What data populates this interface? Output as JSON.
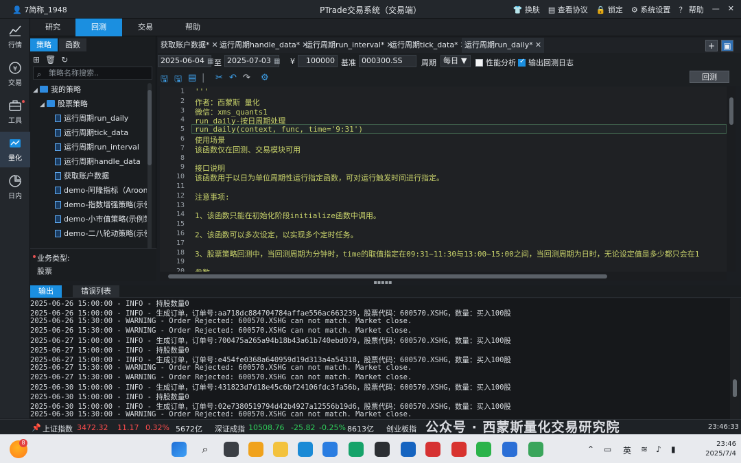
{
  "window": {
    "user": "7简称_1948",
    "title": "PTrade交易系统（交易端）",
    "actions": [
      "换肤",
      "查看协议",
      "锁定",
      "系统设置",
      "帮助"
    ]
  },
  "rail": [
    {
      "label": "行情",
      "icon": "chart-icon"
    },
    {
      "label": "交易",
      "icon": "yuan-icon"
    },
    {
      "label": "工具",
      "icon": "toolbox-icon"
    },
    {
      "label": "量化",
      "icon": "quant-icon"
    },
    {
      "label": "日内",
      "icon": "intraday-icon"
    }
  ],
  "menu": [
    "研究",
    "回测",
    "交易",
    "帮助"
  ],
  "strategy": {
    "tabs": [
      "策略",
      "函数"
    ],
    "search_placeholder": "策略名称搜索..",
    "tree": [
      {
        "label": "我的策略",
        "level": 0,
        "type": "folder"
      },
      {
        "label": "股票策略",
        "level": 1,
        "type": "folder"
      },
      {
        "label": "运行周期run_daily",
        "level": 2,
        "type": "file"
      },
      {
        "label": "运行周期tick_data",
        "level": 2,
        "type": "file"
      },
      {
        "label": "运行周期run_interval",
        "level": 2,
        "type": "file"
      },
      {
        "label": "运行周期handle_data",
        "level": 2,
        "type": "file"
      },
      {
        "label": "获取账户数据",
        "level": 2,
        "type": "file"
      },
      {
        "label": "demo-阿隆指标（Aroon）",
        "level": 2,
        "type": "file"
      },
      {
        "label": "demo-指数增强策略(示例)",
        "level": 2,
        "type": "file"
      },
      {
        "label": "demo-小市值策略(示例策略)",
        "level": 2,
        "type": "file"
      },
      {
        "label": "demo-二八轮动策略(示例)",
        "level": 2,
        "type": "file"
      }
    ],
    "biz_type_label": "业务类型:",
    "biz_type_value": "股票"
  },
  "file_tabs": [
    {
      "label": "获取账户数据*"
    },
    {
      "label": "运行周期handle_data*"
    },
    {
      "label": "运行周期run_interval*"
    },
    {
      "label": "运行周期tick_data*"
    },
    {
      "label": "运行周期run_daily*"
    }
  ],
  "params": {
    "start_date": "2025-06-04",
    "to": "至",
    "end_date": "2025-07-03",
    "currency": "¥",
    "capital": "100000",
    "benchmark_label": "基准",
    "benchmark": "000300.SS",
    "period_label": "周期",
    "period": "每日",
    "perf_analysis": "性能分析",
    "output_log": "输出回测日志"
  },
  "backtest_button": "回测",
  "code": [
    "'''",
    "作者：西蒙斯 量化",
    "微信：xms_quants1",
    "run_daily-按日周期处理",
    "run_daily(context, func, time='9:31')",
    "使用场景",
    "该函数仅在回测、交易模块可用",
    "",
    "接口说明",
    "该函数用于以日为单位周期性运行指定函数，可对运行触发时间进行指定。",
    "",
    "注意事项:",
    "",
    "1、该函数只能在初始化阶段initialize函数中调用。",
    "",
    "2、该函数可以多次设定，以实现多个定时任务。",
    "",
    "3、股票策略回测中，当回测周期为分钟时，time的取值指定在09:31~11:30与13:00~15:00之间，当回测周期为日时，无论设定值是多少都只会在1",
    "",
    "参数"
  ],
  "output": {
    "tabs": [
      "输出",
      "错误列表"
    ],
    "lines": [
      "2025-06-26 15:00:00 - INFO - 持股数量0",
      "2025-06-26 15:00:00 - INFO - 生成订单，订单号:aa718dc884704784affae556ac663239，股票代码：600570.XSHG，数量：买入100股",
      "2025-06-26 15:30:00 - WARNING - Order Rejected: 600570.XSHG can not match. Market close.",
      "2025-06-26 15:30:00 - WARNING - Order Rejected: 600570.XSHG can not match. Market close.",
      "2025-06-27 15:00:00 - INFO - 生成订单，订单号:700475a265a94b18b43a61b740ebd079，股票代码：600570.XSHG，数量：买入100股",
      "2025-06-27 15:00:00 - INFO - 持股数量0",
      "2025-06-27 15:00:00 - INFO - 生成订单，订单号:e454fe0368a640959d19d313a4a54318，股票代码：600570.XSHG，数量：买入100股",
      "2025-06-27 15:30:00 - WARNING - Order Rejected: 600570.XSHG can not match. Market close.",
      "2025-06-27 15:30:00 - WARNING - Order Rejected: 600570.XSHG can not match. Market close.",
      "2025-06-30 15:00:00 - INFO - 生成订单，订单号:431823d7d18e45c6bf24106fdc3fa56b，股票代码：600570.XSHG，数量：买入100股",
      "2025-06-30 15:00:00 - INFO - 持股数量0",
      "2025-06-30 15:00:00 - INFO - 生成订单，订单号:02e7380519794d42b4927a12556b19d6，股票代码：600570.XSHG，数量：买入100股",
      "2025-06-30 15:30:00 - WARNING - Order Rejected: 600570.XSHG can not match. Market close."
    ]
  },
  "ticker": {
    "sh_name": "上证指数",
    "sh_value": "3472.32",
    "sh_change": "11.17",
    "sh_pct": "0.32%",
    "sh_volume": "5672亿",
    "sz_name": "深证成指",
    "sz_value": "10508.76",
    "sz_change": "-25.82",
    "sz_pct": "-0.25%",
    "sz_volume": "8613亿",
    "cy_name": "创业板指",
    "watermark": "公众号 · 西蒙斯量化交易研究院",
    "time": "23:46:33"
  },
  "taskbar": {
    "weather_badge": "8",
    "lang": "英",
    "time": "23:46",
    "date": "2025/7/4"
  },
  "colors": {
    "accent": "#1b8fe0",
    "up": "#ff4d4d",
    "down": "#2fcf5a"
  }
}
